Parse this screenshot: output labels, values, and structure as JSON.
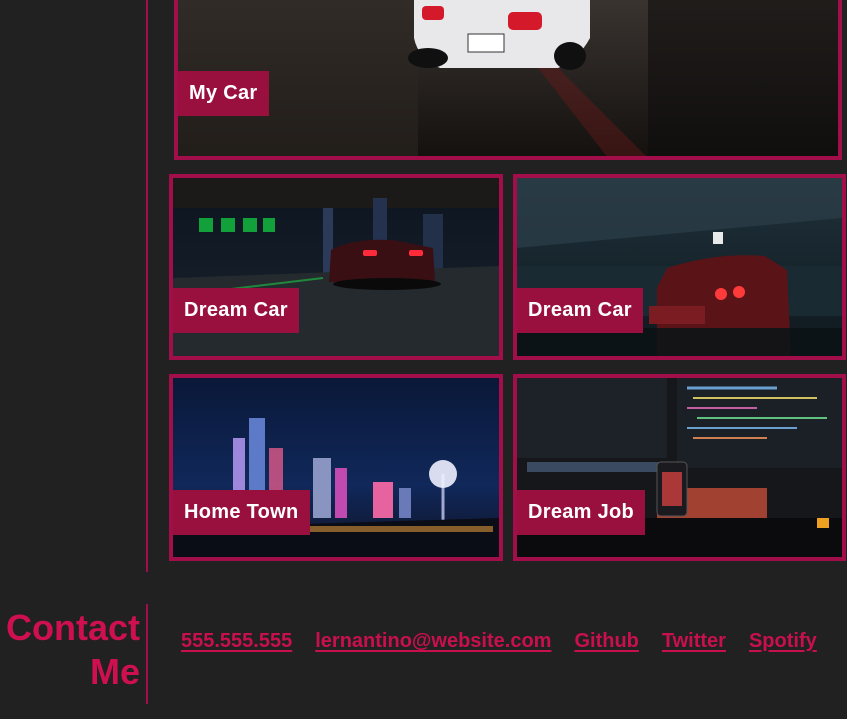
{
  "gallery": {
    "cards": [
      {
        "label": "My Car"
      },
      {
        "label": "Dream Car"
      },
      {
        "label": "Dream Car"
      },
      {
        "label": "Home Town"
      },
      {
        "label": "Dream Job"
      }
    ]
  },
  "contact": {
    "title_line1": "Contact",
    "title_line2": "Me",
    "links": {
      "phone": "555.555.555",
      "email": "lernantino@website.com",
      "github": "Github",
      "twitter": "Twitter",
      "spotify": "Spotify"
    }
  },
  "colors": {
    "background": "#212121",
    "accent": "#a10e4a",
    "label_bg": "#99103f",
    "link": "#c8104e"
  }
}
